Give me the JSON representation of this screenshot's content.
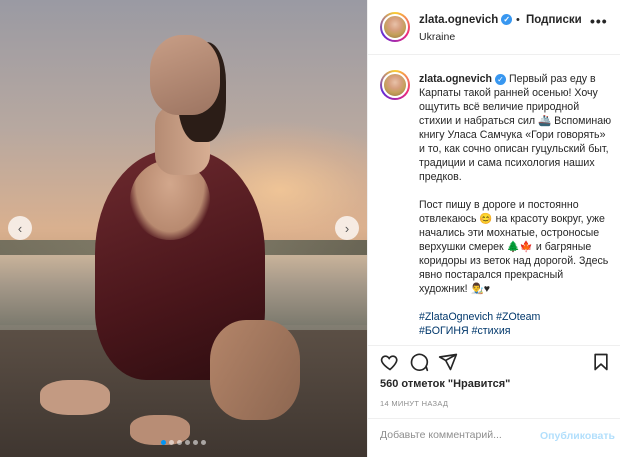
{
  "post": {
    "username": "zlata.ognevich",
    "follow_separator": "•",
    "follow_label": "Подписки",
    "location": "Ukraine",
    "more_label": "•••"
  },
  "caption": {
    "para1": "Первый раз еду в Карпаты такой ранней осенью! Хочу ощутить всё величие природной стихии и набраться сил 🚢 Вспоминаю книгу Уласа Самчука «Гори говорять» и то, как сочно описан гуцульский быт, традиции и сама психология наших предков.",
    "para2": "Пост пишу в дороге и постоянно отвлекаюсь 😊 на красоту вокруг, уже начались эти мохнатые, остроносые верхушки смерек 🌲🍁 и багряные коридоры из веток над дорогой. Здесь явно постарался прекрасный художник! 👨‍🎨♥",
    "tags": [
      "#ZlataOgnevich",
      "#ZOteam",
      "#БОГИНЯ",
      "#стихия"
    ]
  },
  "media": {
    "prev_icon": "‹",
    "next_icon": "›",
    "dots_count": 6,
    "active_dot": 0
  },
  "stats": {
    "likes": "560 отметок \"Нравится\"",
    "time": "14 МИНУТ НАЗАД"
  },
  "comment": {
    "placeholder": "Добавьте комментарий...",
    "post_label": "Опубликовать"
  },
  "icons": [
    "heart-icon",
    "comment-icon",
    "share-icon",
    "bookmark-icon",
    "verified-icon"
  ],
  "colors": {
    "verified": "#3897f0",
    "link": "#00376b",
    "post_disabled": "#b2dffc",
    "active_dot": "#0095f6"
  }
}
